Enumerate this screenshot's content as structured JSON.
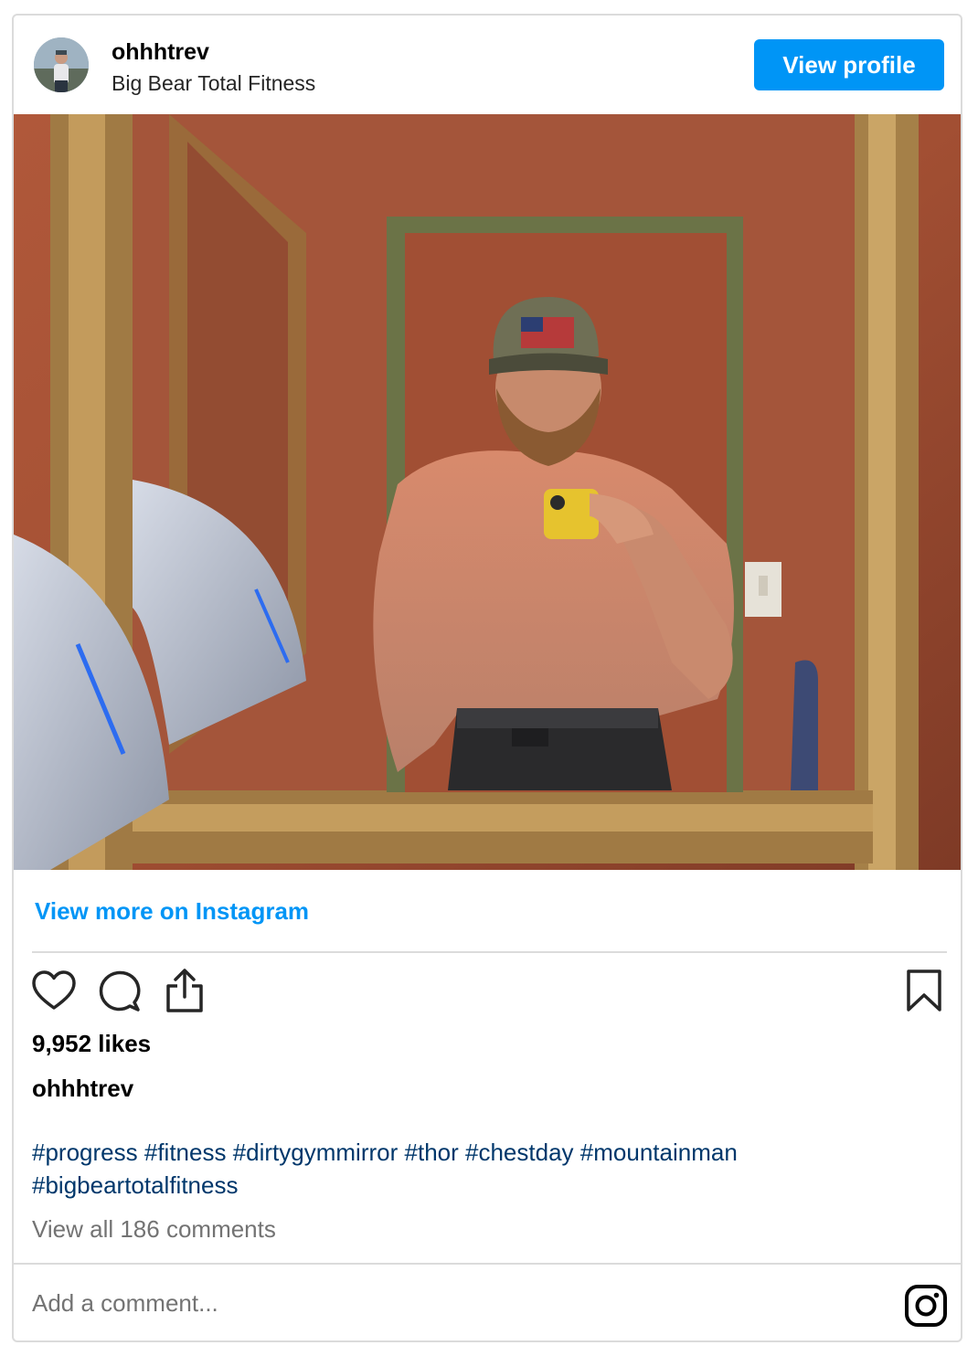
{
  "header": {
    "username": "ohhhtrev",
    "location": "Big Bear Total Fitness",
    "view_profile_label": "View profile",
    "avatar_icon": "profile-avatar"
  },
  "post": {
    "view_more_label": "View more on Instagram",
    "likes": "9,952 likes",
    "caption_username": "ohhhtrev",
    "hashtags": [
      "#progress",
      "#fitness",
      "#dirtygymmirror",
      "#thor",
      "#chestday",
      "#mountainman",
      "#bigbeartotalfitness"
    ],
    "view_comments": "View all 186 comments"
  },
  "actions": {
    "icons": [
      "heart-icon",
      "comment-icon",
      "share-icon",
      "bookmark-icon"
    ]
  },
  "footer": {
    "comment_placeholder": "Add a comment...",
    "logo_icon": "instagram-icon"
  },
  "colors": {
    "accent": "#0095f6",
    "hashtag": "#00376b",
    "muted": "#737373",
    "border": "#dbdbdb"
  }
}
